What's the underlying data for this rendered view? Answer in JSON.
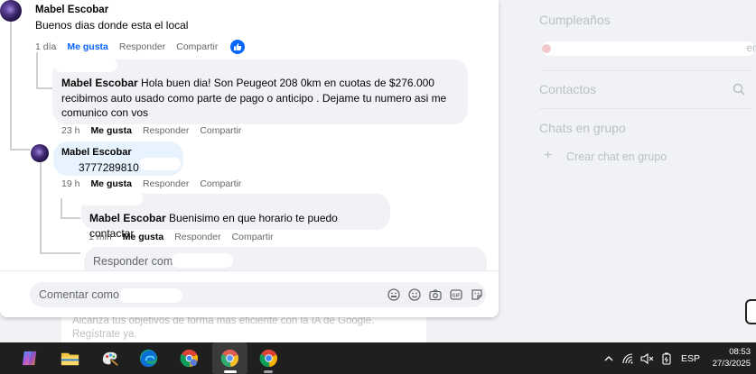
{
  "sidebar": {
    "birthdays_title": "Cumpleaños",
    "birthdays_cut_text": "er",
    "contacts_title": "Contactos",
    "group_chats_title": "Chats en grupo",
    "create_group_plus": "+",
    "create_group_label": "Crear chat en grupo"
  },
  "background_ad": {
    "line1": "Alcanza tus objetivos de forma más eficiente con la IA de Google.",
    "line2": "Regístrate ya."
  },
  "comments": [
    {
      "author": "Mabel Escobar",
      "text": "Buenos dias donde esta el local",
      "time": "1 día",
      "like": "Me gusta",
      "reply": "Responder",
      "share": "Compartir"
    },
    {
      "author": "Mabel Escobar",
      "text": "Hola buen dia! Son Peugeot 208 0km en cuotas de $276.000 recibimos auto usado como parte de pago o anticipo . Dejame tu numero asi me comunico con vos",
      "time": "23 h",
      "like": "Me gusta",
      "reply": "Responder",
      "share": "Compartir"
    },
    {
      "author": "Mabel Escobar",
      "text": "3777289810",
      "time": "19 h",
      "like": "Me gusta",
      "reply": "Responder",
      "share": "Compartir"
    },
    {
      "author": "Mabel Escobar",
      "text": "Buenisimo en que horario te puedo contactar",
      "time": "1 min",
      "like": "Me gusta",
      "reply": "Responder",
      "share": "Compartir"
    }
  ],
  "reply_box": {
    "placeholder": "Responder como"
  },
  "composer": {
    "placeholder": "Comentar como"
  },
  "taskbar": {
    "apps": [
      "copilot-icon",
      "file-explorer-icon",
      "paint-icon",
      "edge-icon",
      "chrome-profile-icon",
      "chrome-icon",
      "chrome-icon"
    ],
    "language": "ESP",
    "time": "08:53",
    "date": "27/3/2025"
  },
  "colors": {
    "like_active": "#0866ff",
    "bubble": "#f0f2f5",
    "highlight_bubble": "#e7f3ff",
    "taskbar": "#1f1f1f"
  }
}
